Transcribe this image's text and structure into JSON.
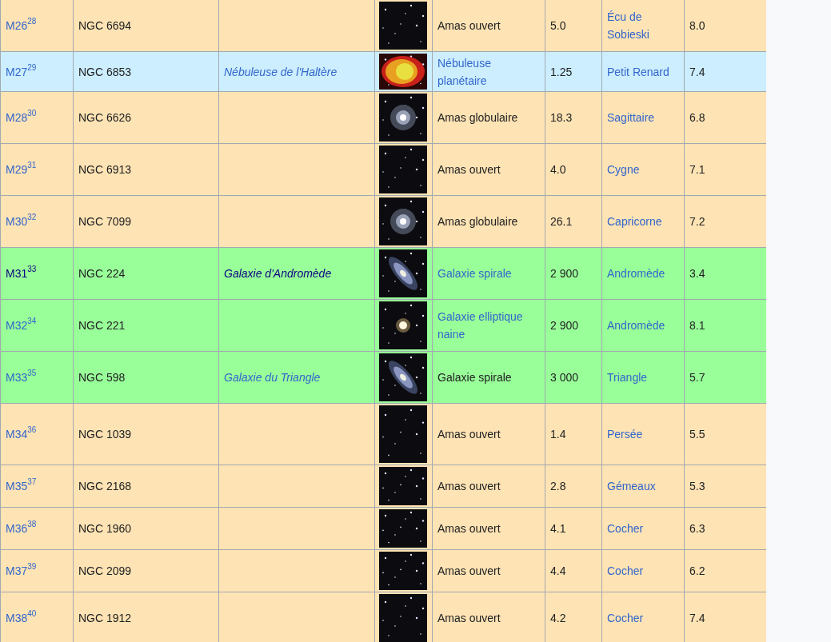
{
  "rows": [
    {
      "color": "#fee3b4",
      "messier": {
        "text": "M26$^{28}$",
        "kind": "link"
      },
      "ngc": "NGC 6694",
      "type": {
        "text": "Amas ouvert",
        "kind": "text"
      },
      "distance": "5.0",
      "constellation": {
        "text": "Écu de Sobieski",
        "kind": "link"
      },
      "magnitude": "8.0"
    },
    {
      "color": "#cceeff",
      "messier": {
        "text": "M27$^{29}$",
        "kind": "link"
      },
      "ngc": "NGC 6853",
      "name": {
        "text": "Nébuleuse de l'Haltère",
        "kind": "link"
      },
      "type": {
        "text": "Nébuleuse planétaire",
        "kind": "link"
      },
      "distance": "1.25",
      "constellation": {
        "text": "Petit Renard",
        "kind": "link"
      },
      "magnitude": "7.4"
    },
    {
      "color": "#fee3b4",
      "messier": {
        "text": "M28$^{30}$",
        "kind": "link"
      },
      "ngc": "NGC 6626",
      "type": {
        "text": "Amas globulaire",
        "kind": "text"
      },
      "distance": "18.3",
      "constellation": {
        "text": "Sagittaire",
        "kind": "link"
      },
      "magnitude": "6.8"
    },
    {
      "color": "#fee3b4",
      "messier": {
        "text": "M29$^{31}$",
        "kind": "link"
      },
      "ngc": "NGC 6913",
      "type": {
        "text": "Amas ouvert",
        "kind": "text"
      },
      "distance": "4.0",
      "constellation": {
        "text": "Cygne",
        "kind": "link"
      },
      "magnitude": "7.1"
    },
    {
      "color": "#fee3b4",
      "messier": {
        "text": "M30$^{32}$",
        "kind": "link"
      },
      "ngc": "NGC 7099",
      "type": {
        "text": "Amas globulaire",
        "kind": "text"
      },
      "distance": "26.1",
      "constellation": {
        "text": "Capricorne",
        "kind": "link"
      },
      "magnitude": "7.2"
    },
    {
      "color": "#99ff99",
      "messier": {
        "text": "M31$^{33}$",
        "kind": "visited"
      },
      "ngc": "NGC 224",
      "name": {
        "text": "Galaxie d'Andromède",
        "kind": "visited"
      },
      "type": {
        "text": "Galaxie spirale",
        "kind": "link"
      },
      "distance": "2 900",
      "constellation": {
        "text": "Andromède",
        "kind": "link"
      },
      "magnitude": "3.4"
    },
    {
      "color": "#99ff99",
      "messier": {
        "text": "M32$^{34}$",
        "kind": "link"
      },
      "ngc": "NGC 221",
      "type": {
        "text": "Galaxie elliptique naine",
        "kind": "link"
      },
      "distance": "2 900",
      "constellation": {
        "text": "Andromède",
        "kind": "link"
      },
      "magnitude": "8.1"
    },
    {
      "color": "#99ff99",
      "messier": {
        "text": "M33$^{35}$",
        "kind": "link"
      },
      "ngc": "NGC 598",
      "name": {
        "text": "Galaxie du Triangle",
        "kind": "link"
      },
      "type": {
        "text": "Galaxie spirale",
        "kind": "text"
      },
      "distance": "3 000",
      "constellation": {
        "text": "Triangle",
        "kind": "link"
      },
      "magnitude": "5.7"
    },
    {
      "color": "#fee3b4",
      "messier": {
        "text": "M34$^{36}$",
        "kind": "link"
      },
      "ngc": "NGC 1039",
      "type": {
        "text": "Amas ouvert",
        "kind": "text"
      },
      "distance": "1.4",
      "constellation": {
        "text": "Persée",
        "kind": "link"
      },
      "magnitude": "5.5"
    },
    {
      "color": "#fee3b4",
      "messier": {
        "text": "M35$^{37}$",
        "kind": "link"
      },
      "ngc": "NGC 2168",
      "type": {
        "text": "Amas ouvert",
        "kind": "text"
      },
      "distance": "2.8",
      "constellation": {
        "text": "Gémeaux",
        "kind": "link"
      },
      "magnitude": "5.3"
    },
    {
      "color": "#fee3b4",
      "messier": {
        "text": "M36$^{38}$",
        "kind": "link"
      },
      "ngc": "NGC 1960",
      "type": {
        "text": "Amas ouvert",
        "kind": "text"
      },
      "distance": "4.1",
      "constellation": {
        "text": "Cocher",
        "kind": "link"
      },
      "magnitude": "6.3"
    },
    {
      "color": "#fee3b4",
      "messier": {
        "text": "M37$^{39}$",
        "kind": "link"
      },
      "ngc": "NGC 2099",
      "type": {
        "text": "Amas ouvert",
        "kind": "text"
      },
      "distance": "4.4",
      "constellation": {
        "text": "Cocher",
        "kind": "link"
      },
      "magnitude": "6.2"
    },
    {
      "color": "#fee3b4",
      "messier": {
        "text": "M38$^{40}$",
        "kind": "link"
      },
      "ngc": "NGC 1912",
      "type": {
        "text": "Amas ouvert",
        "kind": "text"
      },
      "distance": "4.2",
      "constellation": {
        "text": "Cocher",
        "kind": "link"
      },
      "magnitude": "7.4"
    }
  ]
}
